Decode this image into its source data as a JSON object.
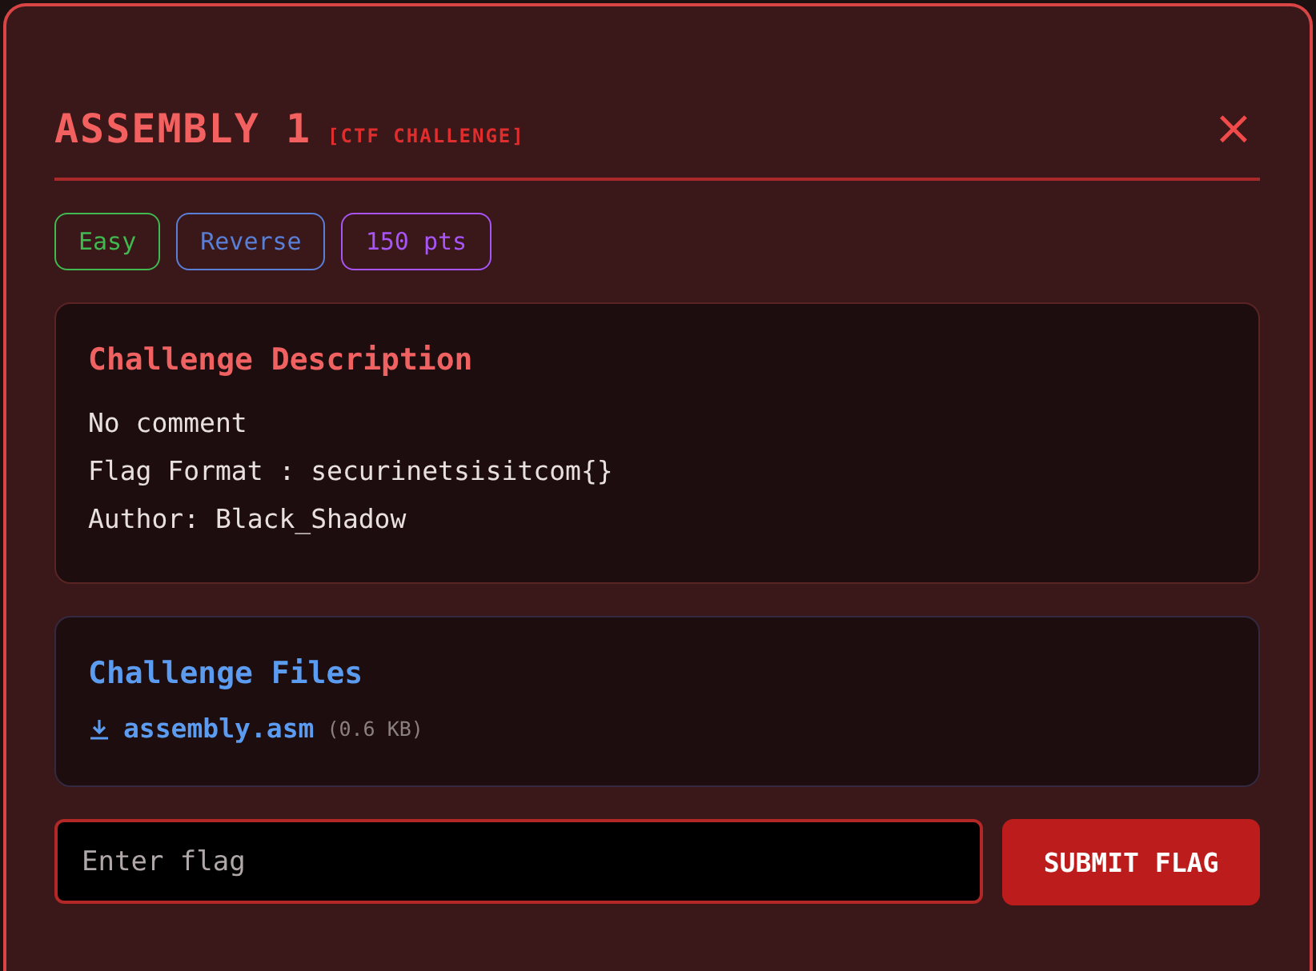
{
  "modal": {
    "title": "ASSEMBLY 1",
    "subtitle": "[CTF CHALLENGE]",
    "close": "×"
  },
  "tags": [
    {
      "label": "Easy",
      "color": "#3fb950"
    },
    {
      "label": "Reverse",
      "color": "#5a7fd6"
    },
    {
      "label": "150 pts",
      "color": "#a855f7"
    }
  ],
  "description": {
    "heading": "Challenge Description",
    "lines": [
      "No comment",
      "Flag Format : securinetsisitcom{}",
      "Author: Black_Shadow"
    ]
  },
  "files": {
    "heading": "Challenge Files",
    "items": [
      {
        "name": "assembly.asm",
        "size": "(0.6 KB)"
      }
    ]
  },
  "flag_form": {
    "placeholder": "Enter flag",
    "button": "SUBMIT FLAG"
  }
}
